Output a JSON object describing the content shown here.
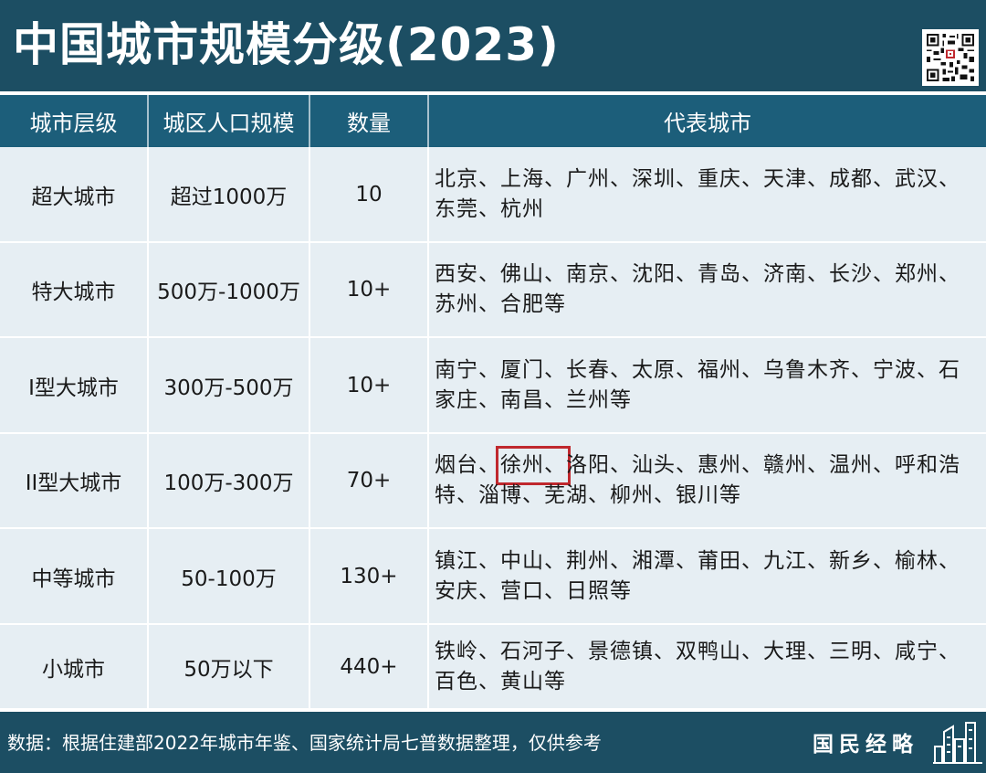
{
  "title": "中国城市规模分级(2023)",
  "table": {
    "headers": [
      "城市层级",
      "城区人口规模",
      "数量",
      "代表城市"
    ],
    "rows": [
      {
        "tier": "超大城市",
        "population": "超过1000万",
        "count": "10",
        "cities_before": "北京、上海、广州、深圳、重庆、天津、成都、武汉、东莞、杭州",
        "cities_highlight": "",
        "cities_after": ""
      },
      {
        "tier": "特大城市",
        "population": "500万-1000万",
        "count": "10+",
        "cities_before": "西安、佛山、南京、沈阳、青岛、济南、长沙、郑州、苏州、合肥等",
        "cities_highlight": "",
        "cities_after": ""
      },
      {
        "tier": "I型大城市",
        "population": "300万-500万",
        "count": "10+",
        "cities_before": "南宁、厦门、长春、太原、福州、乌鲁木齐、宁波、石家庄、南昌、兰州等",
        "cities_highlight": "",
        "cities_after": ""
      },
      {
        "tier": "II型大城市",
        "population": "100万-300万",
        "count": "70+",
        "cities_before": "烟台、",
        "cities_highlight": "徐州、",
        "cities_after": "洛阳、汕头、惠州、赣州、温州、呼和浩特、淄博、芜湖、柳州、银川等"
      },
      {
        "tier": "中等城市",
        "population": "50-100万",
        "count": "130+",
        "cities_before": "镇江、中山、荆州、湘潭、莆田、九江、新乡、榆林、安庆、营口、日照等",
        "cities_highlight": "",
        "cities_after": ""
      },
      {
        "tier": "小城市",
        "population": "50万以下",
        "count": "440+",
        "cities_before": "铁岭、石河子、景德镇、双鸭山、大理、三明、咸宁、百色、黄山等",
        "cities_highlight": "",
        "cities_after": ""
      }
    ]
  },
  "footer": {
    "source": "数据：根据住建部2022年城市年鉴、国家统计局七普数据整理，仅供参考",
    "brand": "国民经略"
  },
  "colors": {
    "header_bg": "#1c4e63",
    "table_header_bg": "#1c5e7a",
    "row_bg": "#e6eef3",
    "highlight_border": "#c0282e"
  },
  "icons": {
    "qr": "qr-code-icon",
    "brand": "city-skyline-icon"
  }
}
